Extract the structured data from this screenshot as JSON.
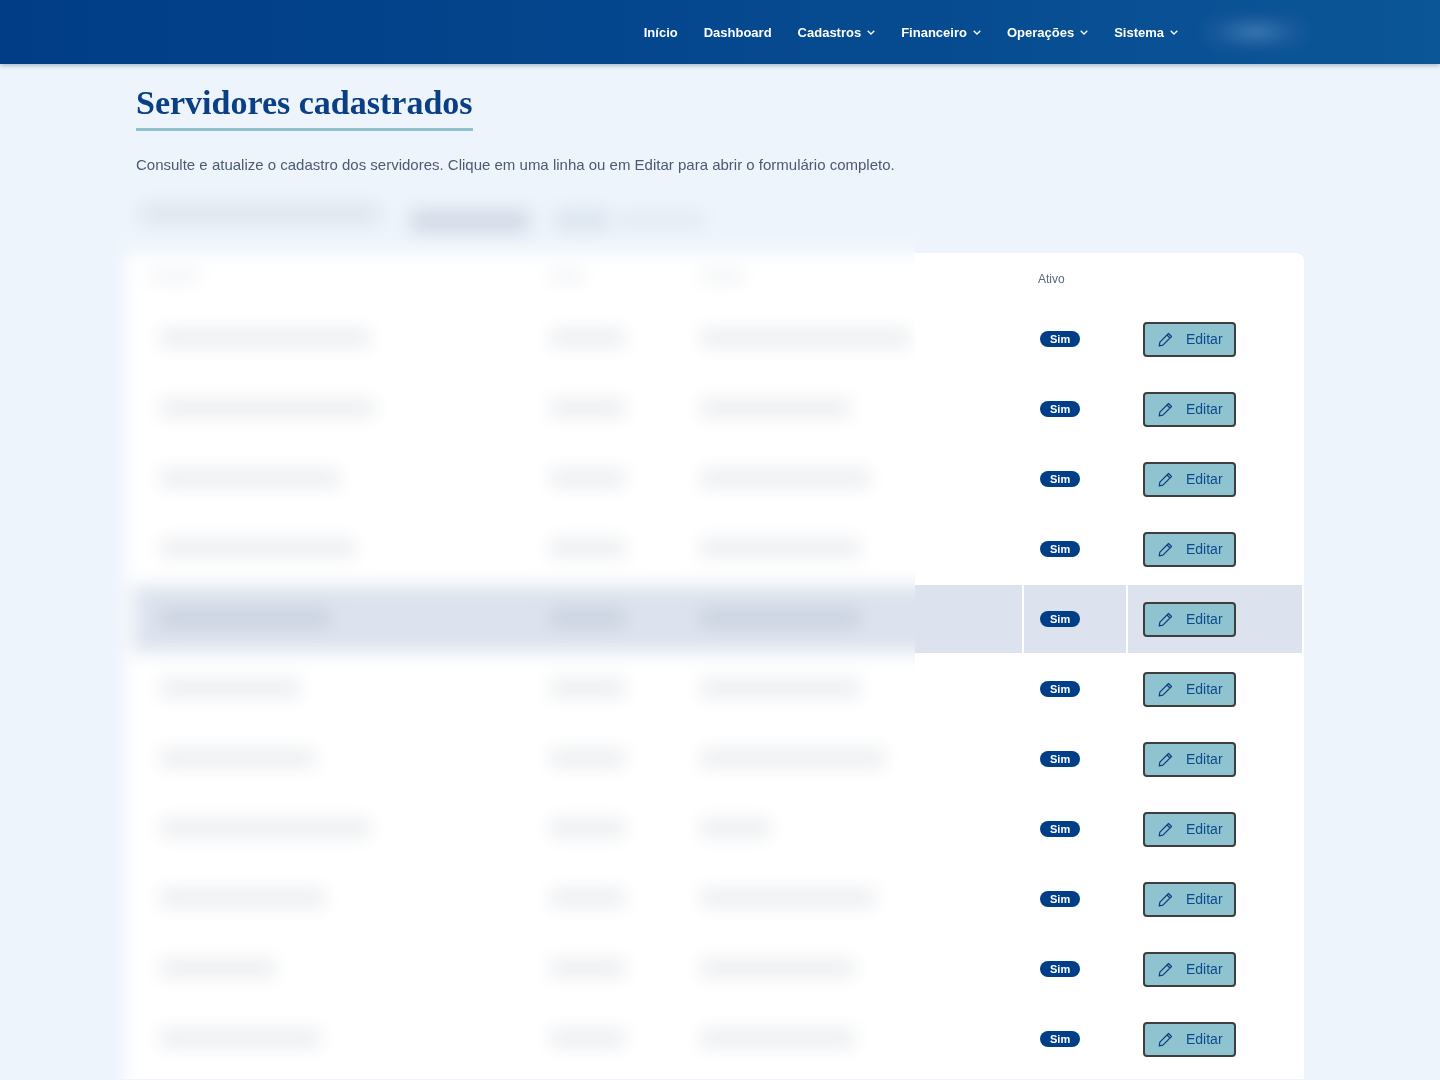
{
  "navbar": {
    "items": [
      {
        "label": "Início",
        "dropdown": false
      },
      {
        "label": "Dashboard",
        "dropdown": false
      },
      {
        "label": "Cadastros",
        "dropdown": true
      },
      {
        "label": "Financeiro",
        "dropdown": true
      },
      {
        "label": "Operações",
        "dropdown": true
      },
      {
        "label": "Sistema",
        "dropdown": true
      }
    ]
  },
  "page": {
    "title": "Servidores cadastrados",
    "description": "Consulte e atualize o cadastro dos servidores. Clique em uma linha ou em Editar para abrir o formulário completo."
  },
  "table": {
    "headers": [
      "Ativo"
    ],
    "rows": [
      {
        "ativo": "Sim",
        "action": "Editar",
        "selected": false
      },
      {
        "ativo": "Sim",
        "action": "Editar",
        "selected": false
      },
      {
        "ativo": "Sim",
        "action": "Editar",
        "selected": false
      },
      {
        "ativo": "Sim",
        "action": "Editar",
        "selected": false
      },
      {
        "ativo": "Sim",
        "action": "Editar",
        "selected": true
      },
      {
        "ativo": "Sim",
        "action": "Editar",
        "selected": false
      },
      {
        "ativo": "Sim",
        "action": "Editar",
        "selected": false
      },
      {
        "ativo": "Sim",
        "action": "Editar",
        "selected": false
      },
      {
        "ativo": "Sim",
        "action": "Editar",
        "selected": false
      },
      {
        "ativo": "Sim",
        "action": "Editar",
        "selected": false
      },
      {
        "ativo": "Sim",
        "action": "Editar",
        "selected": false
      }
    ]
  }
}
